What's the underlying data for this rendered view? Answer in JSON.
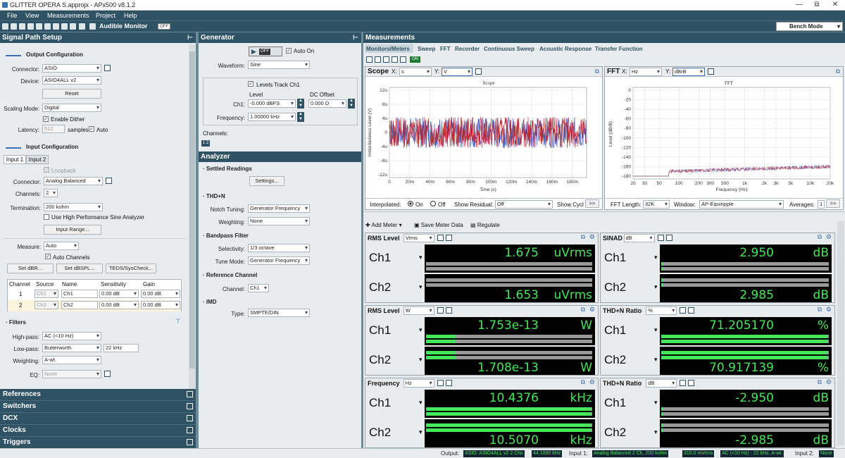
{
  "app": {
    "title": "GLITTER OPERA S.approjx - APx500 v8.1.2",
    "min": "—",
    "max": "⧉",
    "close": "✕"
  },
  "menu": [
    "File",
    "View",
    "Measurements",
    "Project",
    "Help"
  ],
  "toolbar": {
    "audible_monitor": "Audible Monitor",
    "audible_state": "OFF",
    "bench_mode": "Bench Mode"
  },
  "signal_path": {
    "header": "Signal Path Setup",
    "output_configuration": "Output Configuration",
    "connector_label": "Connector:",
    "connector": "ASIO",
    "device_label": "Device:",
    "device": "ASIO4ALL v2",
    "reset": "Reset",
    "scaling_label": "Scaling Mode:",
    "scaling": "Digital",
    "enable_dither": "Enable Dither",
    "latency_label": "Latency:",
    "latency": "512",
    "latency_unit": "samples",
    "auto": "Auto",
    "input_configuration": "Input Configuration",
    "input_tabs": [
      "Input 1",
      "Input 2"
    ],
    "loopback": "Loopback",
    "in_connector_label": "Connector:",
    "in_connector": "Analog Balanced",
    "channels_label": "Channels:",
    "channels": "2",
    "termination_label": "Termination:",
    "termination": "200 kohm",
    "high_perf": "Use High Performance Sine Analyzer",
    "input_range": "Input Range...",
    "measure_label": "Measure:",
    "measure": "Auto",
    "auto_channels": "Auto Channels",
    "set_dbr": "Set dBR...",
    "set_dbspl": "Set dBSPL...",
    "teds": "TEDS/SysCheck...",
    "table_headers": [
      "Channel",
      "Source",
      "Name",
      "Sensitivity",
      "Gain"
    ],
    "table_rows": [
      [
        "1",
        "Ch1",
        "Ch1",
        "0.00 dB",
        "0.00 dB"
      ],
      [
        "2",
        "Ch2",
        "Ch2",
        "0.00 dB",
        "0.00 dB"
      ]
    ],
    "filters": "Filters",
    "highpass_label": "High-pass:",
    "highpass": "AC (<10 Hz)",
    "lowpass_label": "Low-pass:",
    "lowpass": "Butterworth",
    "lowpass_freq": "22 kHz",
    "weighting_label": "Weighting:",
    "weighting": "A-wt.",
    "eq_label": "EQ:",
    "eq": "None"
  },
  "left_tabs": [
    "References",
    "Switchers",
    "DCX",
    "Clocks",
    "Triggers"
  ],
  "generator": {
    "header": "Generator",
    "off": "OFF",
    "auto_on": "Auto On",
    "waveform_label": "Waveform:",
    "waveform": "Sine",
    "levels_track": "Levels Track Ch1",
    "level_label": "Level",
    "dc_label": "DC Offset",
    "ch1_label": "Ch1:",
    "ch1_level": "-0.000 dBFS",
    "ch1_dc": "0.000 D",
    "frequency_label": "Frequency:",
    "frequency": "1.00000 kHz",
    "channels_label": "Channels:",
    "channels_btn": "1 2"
  },
  "analyzer": {
    "header": "Analyzer",
    "settled": "Settled Readings",
    "settings": "Settings...",
    "thdn": "THD+N",
    "notch_label": "Notch Tuning:",
    "notch": "Generator Frequency",
    "weighting_label": "Weighting:",
    "weighting": "None",
    "bandpass": "Bandpass Filter",
    "selectivity_label": "Selectivity:",
    "selectivity": "1/3 octave",
    "tune_label": "Tune Mode:",
    "tune": "Generator Frequency",
    "refch": "Reference Channel",
    "channel_label": "Channel:",
    "channel": "Ch1",
    "imd": "IMD",
    "type_label": "Type:",
    "type": "SMPTE/DIN"
  },
  "measurements": {
    "header": "Measurements",
    "tabs": [
      "Monitors/Meters",
      "Sweep",
      "FFT",
      "Recorder",
      "Continuous Sweep",
      "Acoustic Response",
      "Transfer Function"
    ],
    "on": "ON",
    "scope": {
      "title": "Scope",
      "x": "s",
      "y": "V",
      "plot_title": "Scope",
      "ylabel": "Instantaneous Level (V)",
      "xlabel": "Time (s)",
      "yticks": [
        "12u",
        "8u",
        "4u",
        "0",
        "-4u",
        "-8u",
        "-12u"
      ],
      "xticks": [
        "0",
        "20m",
        "40m",
        "60m",
        "80m",
        "100m",
        "120m",
        "140m",
        "160m",
        "180m"
      ],
      "interpolated": "Interpolated:",
      "on": "On",
      "off": "Off",
      "show_residual": "Show Residual:",
      "residual": "Off",
      "show_cycl": "Show Cycl"
    },
    "fft": {
      "title": "FFT",
      "x": "Hz",
      "y": "dBrB",
      "plot_title": "FFT",
      "ylabel": "Level (dBrB)",
      "xlabel": "Frequency (Hz)",
      "yticks": [
        "0",
        "-20",
        "-40",
        "-60",
        "-80",
        "-100",
        "-120",
        "-140",
        "-160",
        "-180"
      ],
      "xticks": [
        "20",
        "30",
        "50",
        "100",
        "200",
        "300",
        "500",
        "1k",
        "2k",
        "3k",
        "5k",
        "10k",
        "20k"
      ],
      "length_label": "FFT Length:",
      "length": "32K",
      "window_label": "Window:",
      "window": "AP-Equiripple",
      "averages_label": "Averages:",
      "averages": "1"
    },
    "meter_toolbar": {
      "add": "Add Meter",
      "save": "Save Meter Data",
      "regulate": "Regulate"
    },
    "meters": [
      {
        "title": "RMS Level",
        "unit_sel": "Vrms",
        "ch1": "1.675",
        "ch2": "1.653",
        "unit": "uVrms"
      },
      {
        "title": "SINAD",
        "unit_sel": "dB",
        "ch1": "2.950",
        "ch2": "2.985",
        "unit": "dB"
      },
      {
        "title": "RMS Level",
        "unit_sel": "W",
        "ch1": "1.753e-13",
        "ch2": "1.708e-13",
        "unit": "W"
      },
      {
        "title": "THD+N Ratio",
        "unit_sel": "%",
        "ch1": "71.205170",
        "ch2": "70.917139",
        "unit": "%"
      },
      {
        "title": "Frequency",
        "unit_sel": "Hz",
        "ch1": "10.4376",
        "ch2": "10.5070",
        "unit": "kHz"
      },
      {
        "title": "THD+N Ratio",
        "unit_sel": "dB",
        "ch1": "-2.950",
        "ch2": "-2.985",
        "unit": "dB"
      }
    ],
    "ch_labels": [
      "Ch1",
      "Ch2"
    ]
  },
  "status": {
    "output_label": "Output:",
    "output": "ASIO: ASIO4ALL v2 2 Chs",
    "output_rate": "44.1000 kHz",
    "input1_label": "Input 1:",
    "input1": "Analog Balanced 2 Ch, 200 kohm",
    "input1_range": "310.0 mVrms",
    "input1_filter": "AC (<10 Hz) - 22 kHz, A-wt.",
    "input2_label": "Input 2:",
    "input2": "None"
  }
}
